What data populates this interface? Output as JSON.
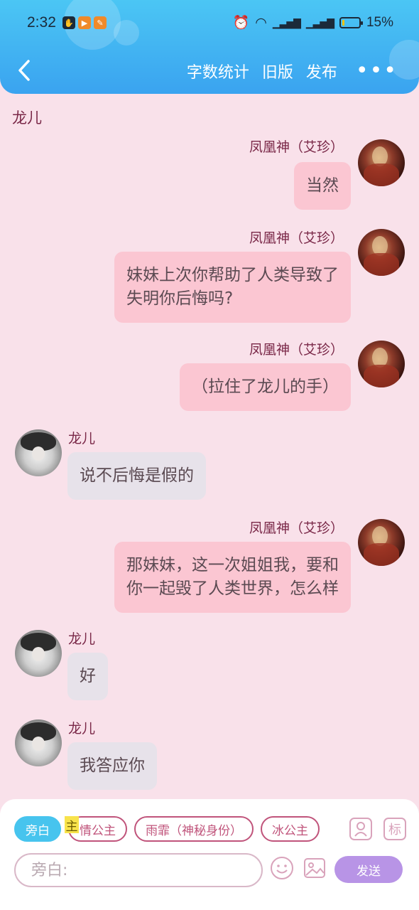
{
  "status_bar": {
    "time": "2:32",
    "battery_text": "15%",
    "battery_level": 0.15
  },
  "header": {
    "actions": [
      "字数统计",
      "旧版",
      "发布"
    ],
    "more": "•••"
  },
  "chat_title": "龙儿",
  "messages": [
    {
      "side": "right",
      "sender": "凤凰神（艾珍）",
      "lines": [
        "当然"
      ]
    },
    {
      "side": "right",
      "sender": "凤凰神（艾珍）",
      "lines": [
        "妹妹上次你帮助了人类导致了",
        "失明你后悔吗?"
      ]
    },
    {
      "side": "right",
      "sender": "凤凰神（艾珍）",
      "lines": [
        "（拉住了龙儿的手）"
      ]
    },
    {
      "side": "left",
      "sender": "龙儿",
      "lines": [
        "说不后悔是假的"
      ]
    },
    {
      "side": "right",
      "sender": "凤凰神（艾珍）",
      "lines": [
        "那妹妹，这一次姐姐我，要和",
        "你一起毁了人类世界，怎么样"
      ]
    },
    {
      "side": "left",
      "sender": "龙儿",
      "lines": [
        "好"
      ]
    },
    {
      "side": "left",
      "sender": "龙儿",
      "lines": [
        "我答应你"
      ]
    }
  ],
  "role_chips": [
    "旁白",
    "情公主",
    "雨霏（神秘身份）",
    "冰公主"
  ],
  "role_marker": "主",
  "role_icons": [
    "标"
  ],
  "input": {
    "placeholder": "旁白:"
  },
  "send_label": "发送",
  "colors": {
    "accent": "#47c4ee",
    "send": "#b894e6",
    "right_bubble": "#fbc6d2",
    "left_bubble": "#e7e2ea",
    "background": "#f9e1ea"
  }
}
